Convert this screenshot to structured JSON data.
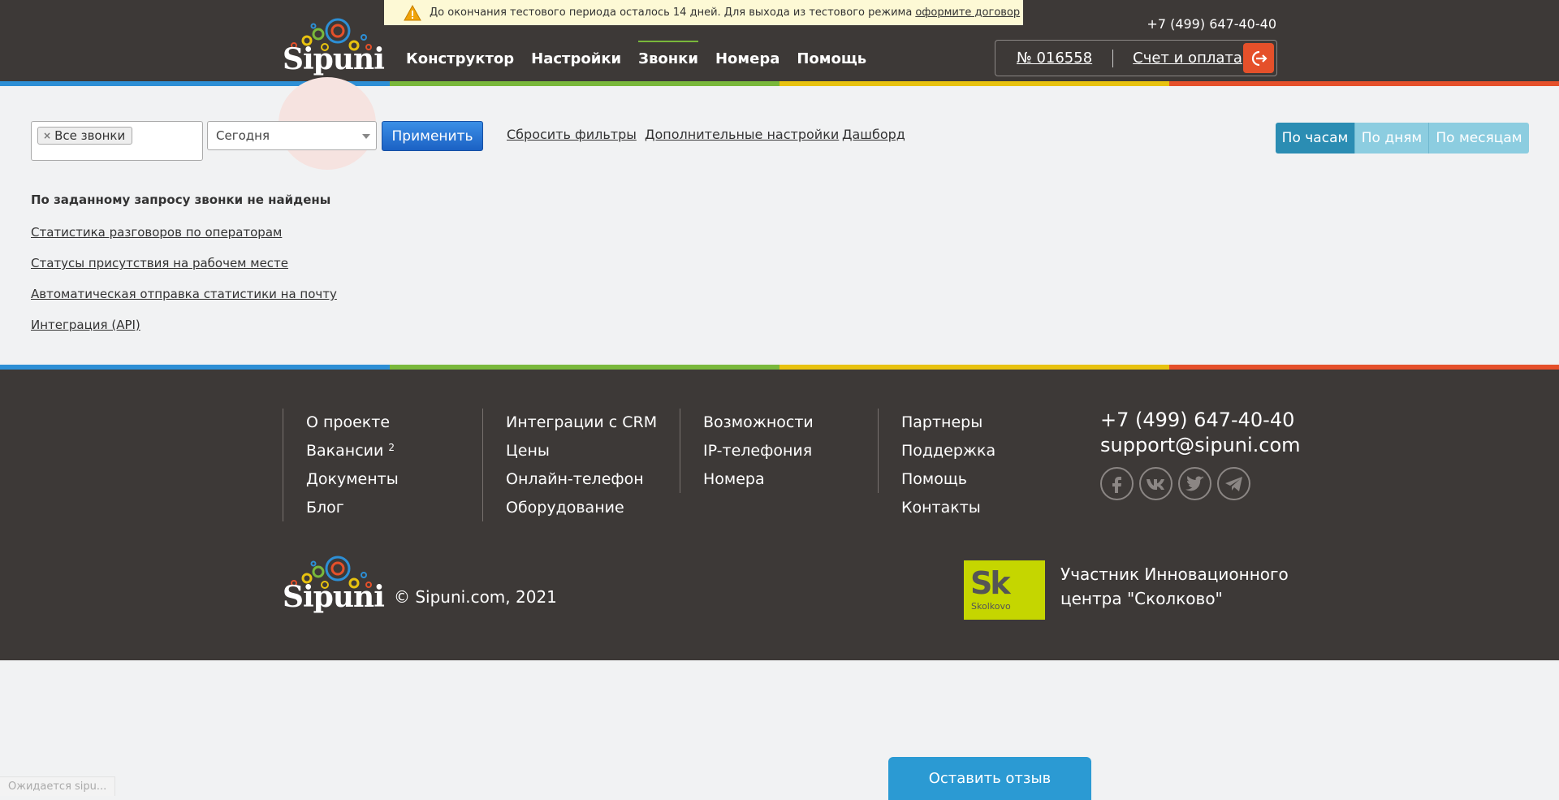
{
  "trial_banner": {
    "text": "До окончания тестового периода осталось 14 дней. Для выхода из тестового режима",
    "link": "оформите договор"
  },
  "header": {
    "logo_text": "Sipuni",
    "nav": [
      {
        "label": "Конструктор"
      },
      {
        "label": "Настройки"
      },
      {
        "label": "Звонки",
        "active": true
      },
      {
        "label": "Номера"
      },
      {
        "label": "Помощь"
      }
    ],
    "phone": "+7 (499) 647-40-40",
    "account_number": "№ 016558",
    "billing_link": "Счет и оплата"
  },
  "filters": {
    "tag": "Все звонки",
    "period": "Сегодня",
    "apply": "Применить",
    "reset": "Сбросить фильтры",
    "advanced": "Дополнительные настройки",
    "dashboard": "Дашборд"
  },
  "grouping": {
    "hours": "По часам",
    "days": "По дням",
    "months": "По месяцам",
    "selected": "hours"
  },
  "main": {
    "empty_message": "По заданному запросу звонки не найдены",
    "links": [
      "Статистика разговоров по операторам",
      "Статусы присутствия на рабочем месте",
      "Автоматическая отправка статистики на почту",
      "Интеграция (API)"
    ]
  },
  "footer": {
    "col1": [
      "О проекте",
      "Вакансии",
      "Документы",
      "Блог"
    ],
    "vacancies_badge": "2",
    "col2": [
      "Интеграции с CRM",
      "Цены",
      "Онлайн-телефон",
      "Оборудование"
    ],
    "col3": [
      "Возможности",
      "IP-телефония",
      "Номера"
    ],
    "col4": [
      "Партнеры",
      "Поддержка",
      "Помощь",
      "Контакты"
    ],
    "phone": "+7 (499) 647-40-40",
    "email": "support@sipuni.com",
    "social": [
      "facebook-icon",
      "vk-icon",
      "twitter-icon",
      "telegram-icon"
    ],
    "logo_text": "Sipuni",
    "copyright": "© Sipuni.com, 2021",
    "skolkovo_mark": "Sk",
    "skolkovo_word": "Skolkovo",
    "skolkovo_line1": "Участник Инновационного",
    "skolkovo_line2": "центра \"Сколково\""
  },
  "feedback_button": "Оставить отзыв",
  "browser_status": "Ожидается sipu...",
  "colors": {
    "dark": "#3d3937",
    "stripe": [
      "#2d8fd5",
      "#79b83b",
      "#e8c20f",
      "#e5502a"
    ],
    "accent_red": "#e5502a",
    "apply_blue": "#1b61c4",
    "segment_on": "#2b8db3",
    "segment_off": "#8ccde0",
    "feedback": "#2b9ad3",
    "skolkovo": "#c5d600"
  }
}
